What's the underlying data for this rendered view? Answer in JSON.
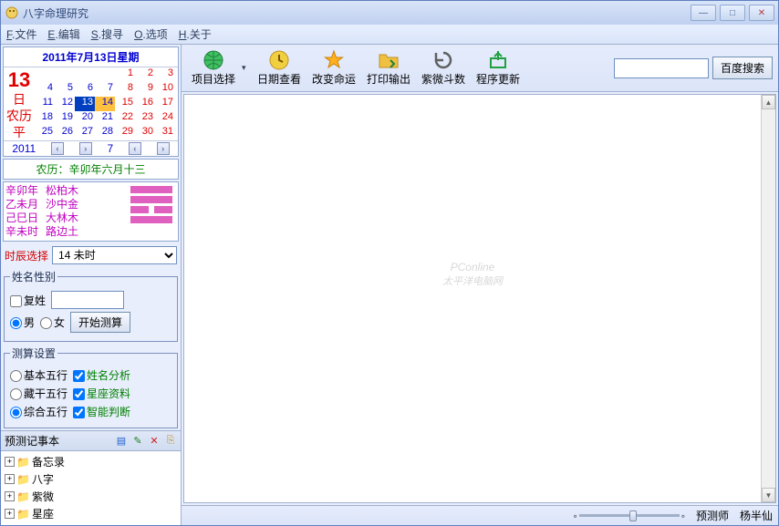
{
  "title": "八字命理研究",
  "menu": [
    "F.文件",
    "E.编辑",
    "S.搜寻",
    "O.选项",
    "H.关于"
  ],
  "toolbar": [
    {
      "label": "项目选择",
      "icon": "globe",
      "dropdown": true
    },
    {
      "label": "日期查看",
      "icon": "clock"
    },
    {
      "label": "改变命运",
      "icon": "star"
    },
    {
      "label": "打印输出",
      "icon": "folder"
    },
    {
      "label": "紫微斗数",
      "icon": "refresh"
    },
    {
      "label": "程序更新",
      "icon": "update"
    }
  ],
  "search_button": "百度搜索",
  "calendar": {
    "header": "2011年7月13日星期",
    "big_num": "13",
    "big_labels": [
      "日",
      "农历",
      "平"
    ],
    "year": "2011",
    "month": "7",
    "lunar": "农历：辛卯年六月十三"
  },
  "bazi": {
    "col1": [
      "辛卯年",
      "乙未月",
      "己巳日",
      "辛未时"
    ],
    "col2": [
      "松柏木",
      "沙中金",
      "大林木",
      "路边土"
    ]
  },
  "shichen": {
    "label": "时辰选择",
    "value": "14 未时"
  },
  "name_section": {
    "legend": "姓名性别",
    "fuxing": "复姓",
    "male": "男",
    "female": "女",
    "calc": "开始测算"
  },
  "settings": {
    "legend": "测算设置",
    "opts": [
      {
        "r": "基本五行",
        "c": "姓名分析"
      },
      {
        "r": "藏干五行",
        "c": "星座资料"
      },
      {
        "r": "综合五行",
        "c": "智能判断"
      }
    ]
  },
  "notes": {
    "title": "预测记事本",
    "items": [
      "备忘录",
      "八字",
      "紫微",
      "星座"
    ]
  },
  "status": {
    "label": "预测师",
    "name": "杨半仙"
  },
  "watermark": {
    "main": "PConline",
    "sub": "太平洋电脑网"
  }
}
